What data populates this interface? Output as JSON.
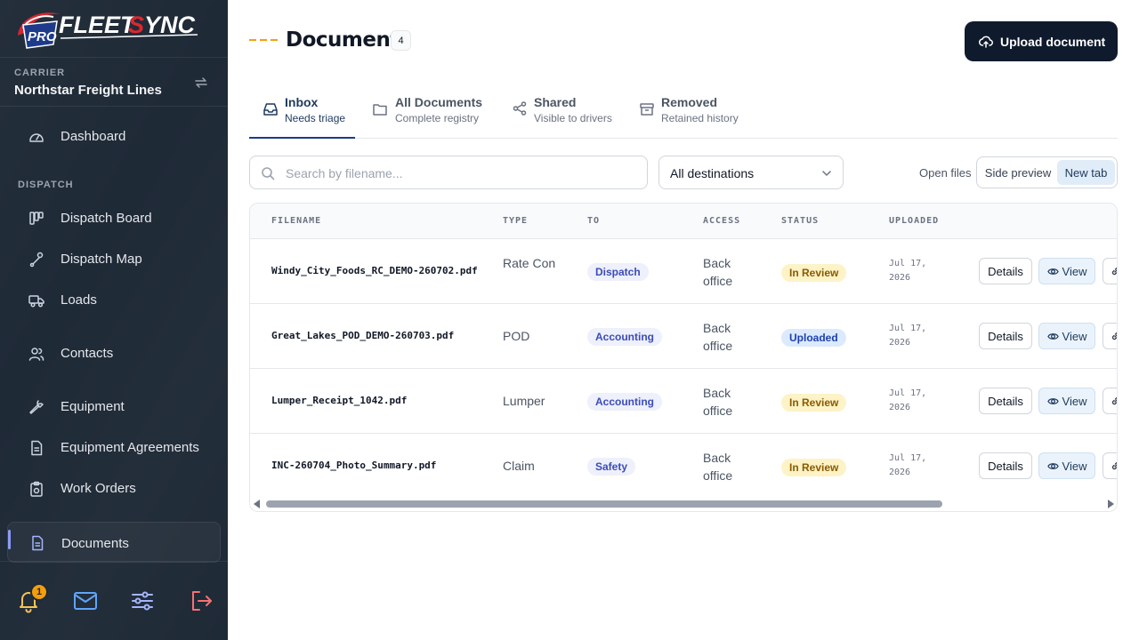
{
  "app": {
    "brand_pro": "PRO",
    "brand_name_a": "FLEET",
    "brand_name_s": "S",
    "brand_name_b": "YNC"
  },
  "carrier": {
    "label": "CARRIER",
    "name": "Northstar Freight Lines"
  },
  "nav": {
    "dashboard": "Dashboard",
    "section_dispatch": "DISPATCH",
    "dispatch_board": "Dispatch Board",
    "dispatch_map": "Dispatch Map",
    "loads": "Loads",
    "contacts": "Contacts",
    "equipment": "Equipment",
    "equipment_agreements": "Equipment Agreements",
    "work_orders": "Work Orders",
    "documents": "Documents"
  },
  "footer": {
    "notification_count": "1"
  },
  "header": {
    "title": "Documents",
    "count": "4",
    "upload_label": "Upload document"
  },
  "tabs": [
    {
      "title": "Inbox",
      "sub": "Needs triage"
    },
    {
      "title": "All Documents",
      "sub": "Complete registry"
    },
    {
      "title": "Shared",
      "sub": "Visible to drivers"
    },
    {
      "title": "Removed",
      "sub": "Retained history"
    }
  ],
  "filters": {
    "search_placeholder": "Search by filename...",
    "destination": "All destinations",
    "open_files_label": "Open files",
    "open_side_preview": "Side preview",
    "open_new_tab": "New tab"
  },
  "table": {
    "headers": [
      "FILENAME",
      "TYPE",
      "TO",
      "ACCESS",
      "STATUS",
      "UPLOADED"
    ],
    "rows": [
      {
        "filename": "Windy_City_Foods_RC_DEMO-260702.pdf",
        "type": "Rate Con",
        "to": "Dispatch",
        "access": "Back office",
        "status": "In Review",
        "uploaded": "Jul 17, 2026"
      },
      {
        "filename": "Great_Lakes_POD_DEMO-260703.pdf",
        "type": "POD",
        "to": "Accounting",
        "access": "Back office",
        "status": "Uploaded",
        "uploaded": "Jul 17, 2026"
      },
      {
        "filename": "Lumper_Receipt_1042.pdf",
        "type": "Lumper",
        "to": "Accounting",
        "access": "Back office",
        "status": "In Review",
        "uploaded": "Jul 17, 2026"
      },
      {
        "filename": "INC-260704_Photo_Summary.pdf",
        "type": "Claim",
        "to": "Safety",
        "access": "Back office",
        "status": "In Review",
        "uploaded": "Jul 17, 2026"
      }
    ],
    "details_label": "Details",
    "view_label": "View"
  }
}
